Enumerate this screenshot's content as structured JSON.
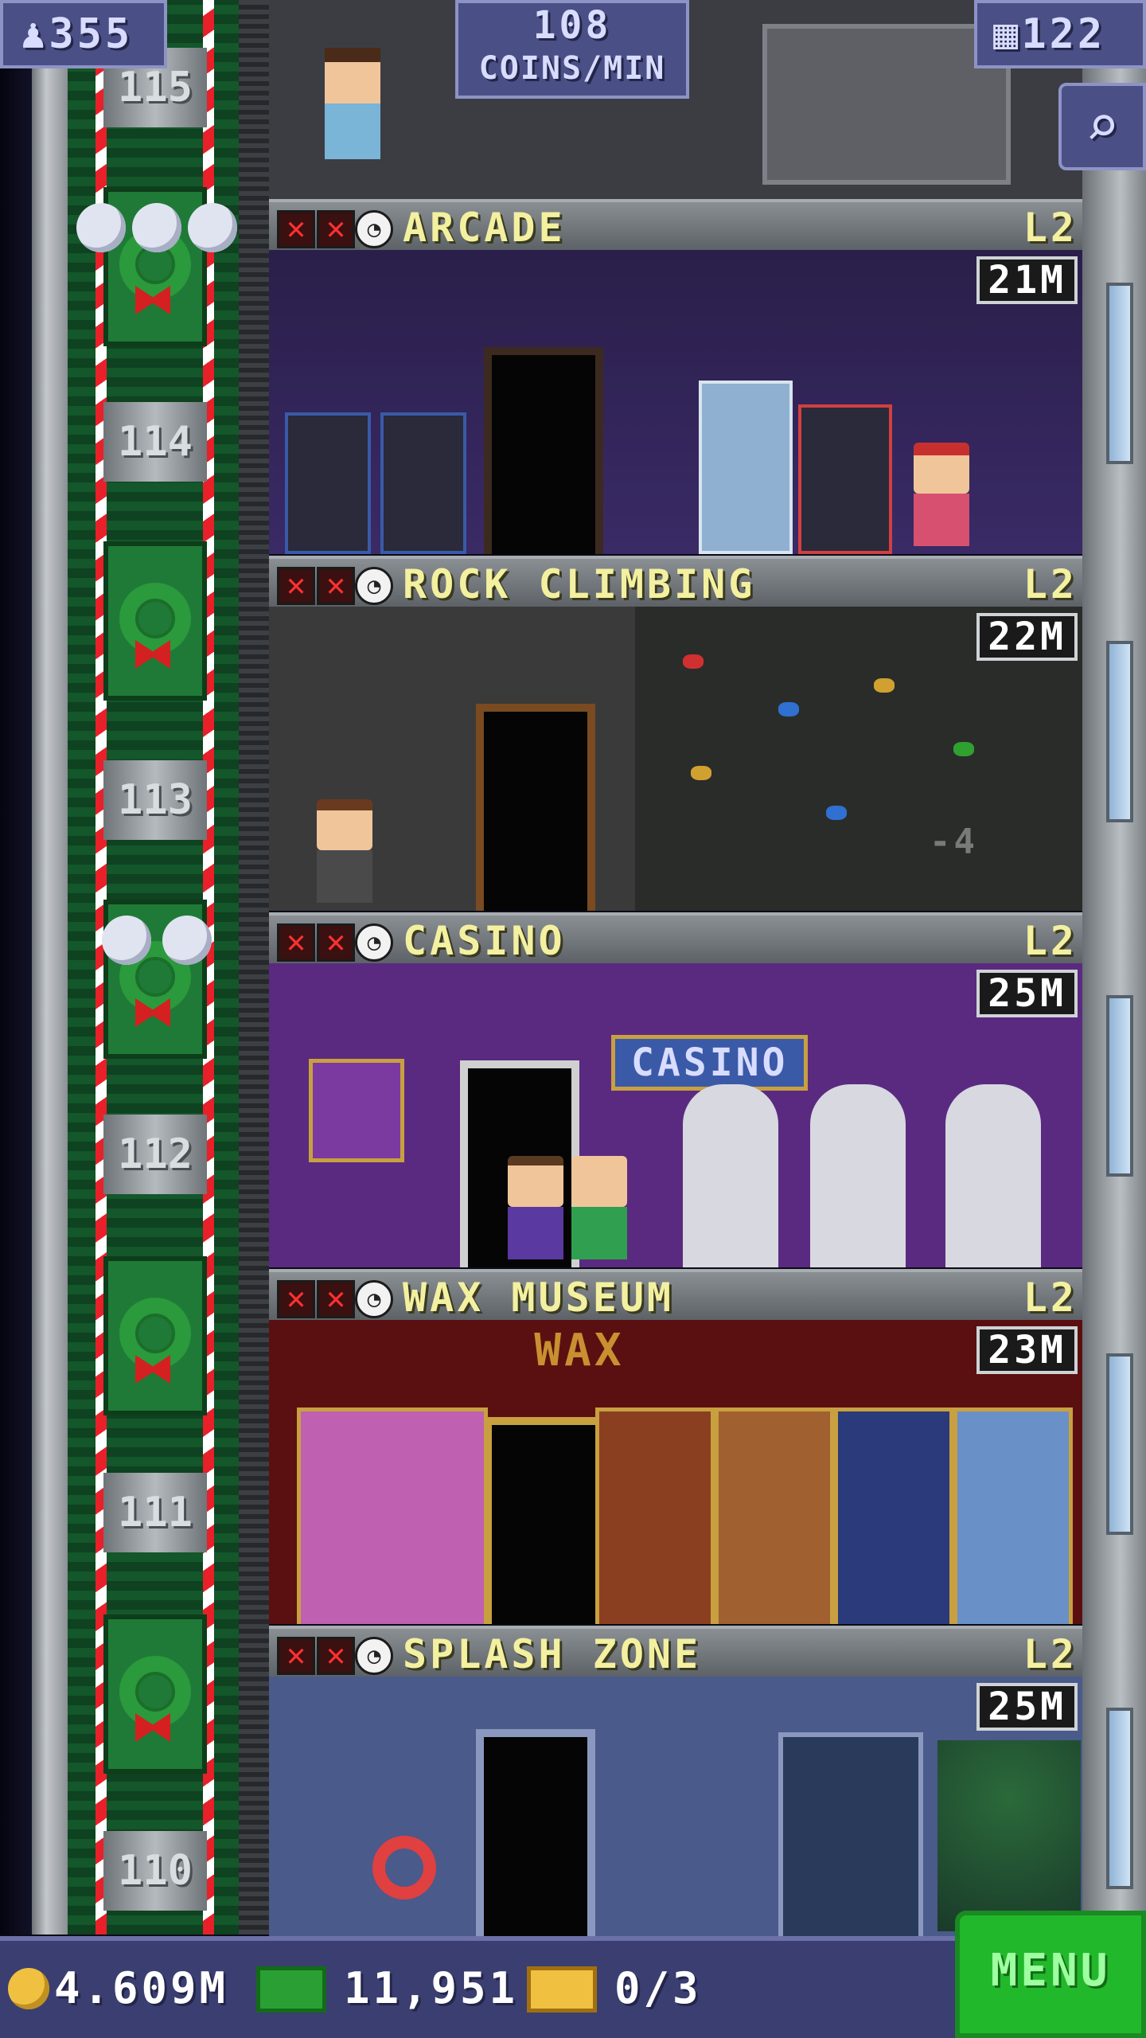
{
  "hud": {
    "population": "355",
    "coins_rate_value": "108",
    "coins_rate_label": "COINS/MIN",
    "floors": "122"
  },
  "elevator": {
    "floor_numbers": [
      "115",
      "114",
      "113",
      "112",
      "111",
      "110"
    ]
  },
  "floors": [
    {
      "name": "ARCADE",
      "level": "L2",
      "timer": "21M"
    },
    {
      "name": "ROCK CLIMBING",
      "level": "L2",
      "timer": "22M",
      "floating_text": "-4"
    },
    {
      "name": "CASINO",
      "level": "L2",
      "timer": "25M",
      "sign": "CASINO"
    },
    {
      "name": "WAX MUSEUM",
      "level": "L2",
      "timer": "23M",
      "sign": "WAX"
    },
    {
      "name": "SPLASH ZONE",
      "level": "L2",
      "timer": "25M"
    }
  ],
  "bottom_bar": {
    "coins": "4.609M",
    "bux": "11,951",
    "tickets": "0/3",
    "menu_label": "MENU"
  },
  "colors": {
    "hud_bg": "#4a4f86",
    "floor_title": "#f3f0a0",
    "menu_green": "#22b82c",
    "elevator_green": "#1f7a37",
    "candy_red": "#e8202a"
  }
}
